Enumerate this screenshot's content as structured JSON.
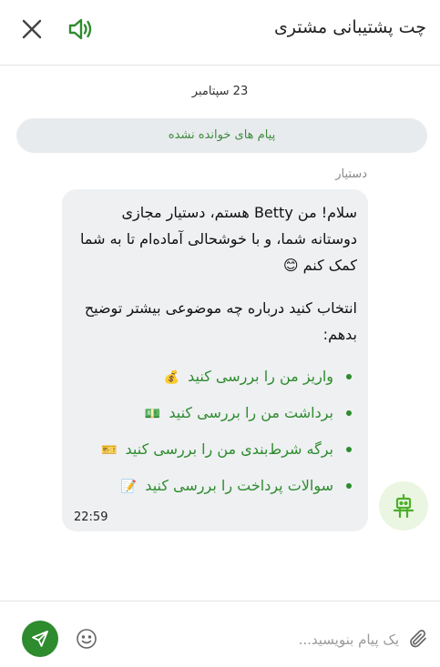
{
  "header": {
    "title": "چت پشتیبانی مشتری",
    "close_icon": "close-icon",
    "sound_icon": "speaker-icon"
  },
  "conversation": {
    "date": "23 سپتامبر",
    "unread_label": "پیام های خوانده نشده",
    "sender_name": "دستیار",
    "message": {
      "greeting": "سلام! من Betty هستم، دستیار مجازی دوستانه شما، و با خوشحالی آماده‌ام تا به شما کمک کنم 😊",
      "prompt": "انتخاب کنید درباره چه موضوعی بیشتر توضیح بدهم:",
      "options": [
        {
          "label": "واریز من را بررسی کنید",
          "emoji": "💰"
        },
        {
          "label": "برداشت من را بررسی کنید",
          "emoji": "💵"
        },
        {
          "label": "برگه شرط‌بندی من را بررسی کنید",
          "emoji": "🎫"
        },
        {
          "label": "سوالات پرداخت را بررسی کنید",
          "emoji": "📝"
        }
      ],
      "time": "22:59"
    },
    "avatar_icon": "robot-icon"
  },
  "composer": {
    "placeholder": "یک پیام بنویسید...",
    "value": ""
  },
  "colors": {
    "accent": "#2e8b2e",
    "bubble": "#eef0f2",
    "avatar_bg": "#eaf6e1"
  }
}
